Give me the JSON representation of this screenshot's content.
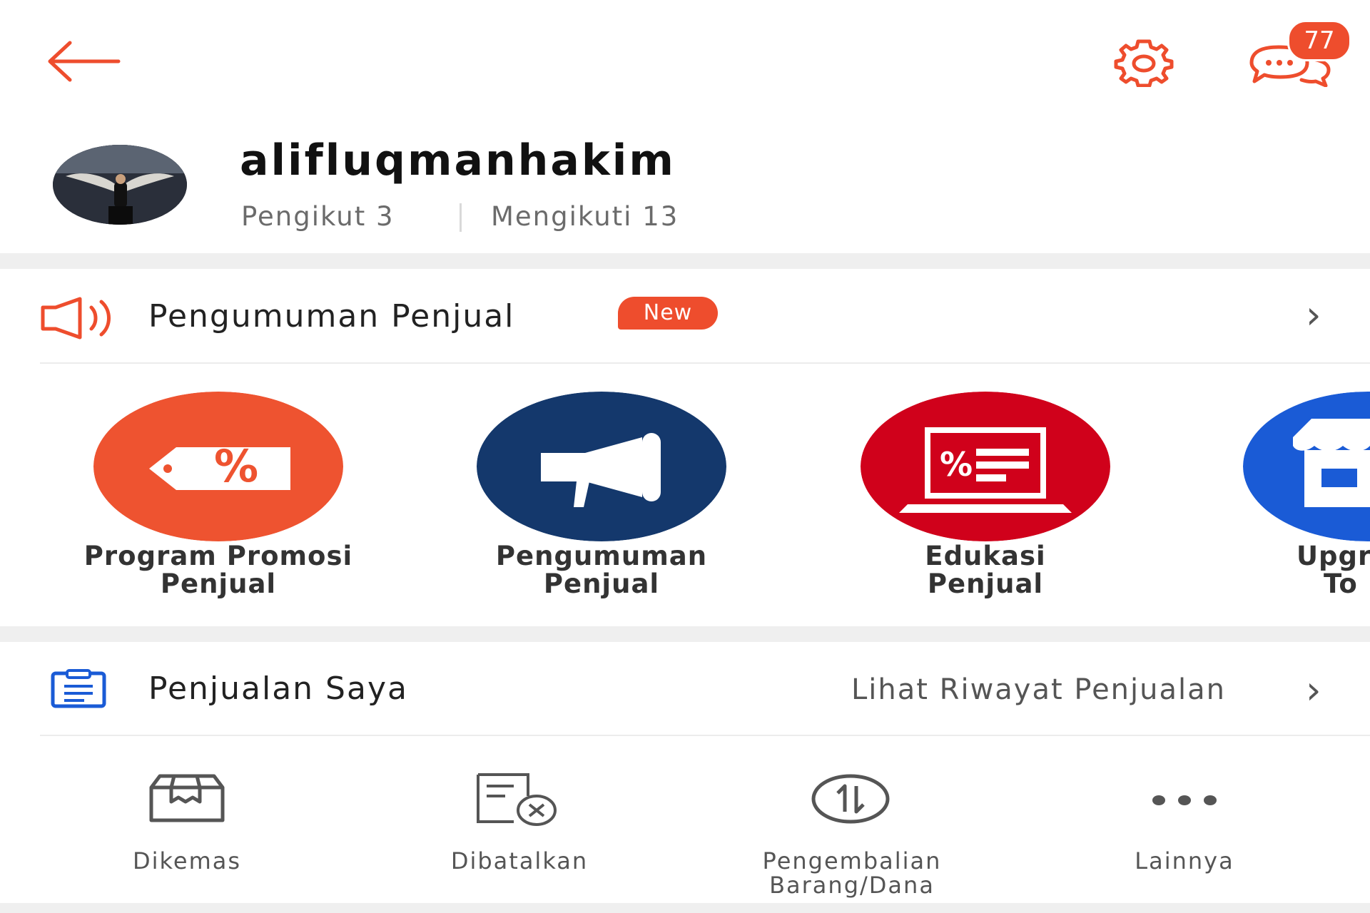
{
  "colors": {
    "accent": "#ee4d2d",
    "navy": "#14386c",
    "red": "#d0011b",
    "blue": "#1a5bd6"
  },
  "header": {
    "back_icon": "arrow-left-icon",
    "settings_icon": "gear-icon",
    "chat_icon": "chat-bubbles-icon",
    "chat_badge": "77"
  },
  "profile": {
    "username": "alifluqmanhakim",
    "followers": "Pengikut 3",
    "following": "Mengikuti 13"
  },
  "announcement": {
    "title": "Pengumuman Penjual",
    "badge": "New",
    "icon": "megaphone-icon"
  },
  "features": [
    {
      "line1": "Program Promosi",
      "line2": "Penjual",
      "icon": "discount-tag-icon"
    },
    {
      "line1": "Pengumuman",
      "line2": "Penjual",
      "icon": "megaphone-icon"
    },
    {
      "line1": "Edukasi",
      "line2": "Penjual",
      "icon": "laptop-icon"
    },
    {
      "line1": "Upgr",
      "line2": "To",
      "icon": "store-icon"
    }
  ],
  "sales": {
    "title": "Penjualan Saya",
    "history_link": "Lihat Riwayat Penjualan",
    "icon": "clipboard-icon",
    "statuses": [
      {
        "line1": "Dikemas",
        "line2": "",
        "icon": "box-icon"
      },
      {
        "line1": "Dibatalkan",
        "line2": "",
        "icon": "cancelled-doc-icon"
      },
      {
        "line1": "Pengembalian",
        "line2": "Barang/Dana",
        "icon": "return-arrows-icon"
      },
      {
        "line1": "Lainnya",
        "line2": "",
        "icon": "more-dots-icon"
      }
    ]
  }
}
